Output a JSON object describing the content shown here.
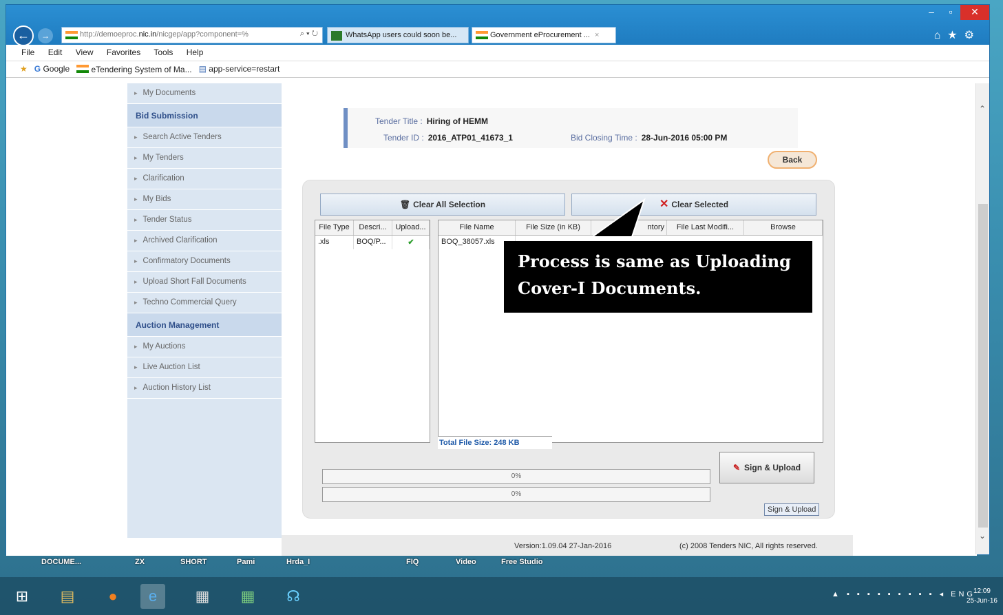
{
  "browser": {
    "address": {
      "prefix": "http://demoeproc.",
      "host": "nic.in",
      "suffix": "/nicgep/app?component=%"
    },
    "tabs": [
      {
        "label": "WhatsApp users could soon be..."
      },
      {
        "label": "Government eProcurement ..."
      }
    ],
    "menu": [
      "File",
      "Edit",
      "View",
      "Favorites",
      "Tools",
      "Help"
    ],
    "favorites": [
      "Google",
      "eTendering System of Ma...",
      "app-service=restart"
    ]
  },
  "sidebar": {
    "items_top": [
      "My Documents"
    ],
    "section_bid": "Bid Submission",
    "items_bid": [
      "Search Active Tenders",
      "My Tenders",
      "Clarification",
      "My Bids",
      "Tender Status",
      "Archived Clarification",
      "Confirmatory Documents",
      "Upload Short Fall Documents",
      "Techno Commercial Query"
    ],
    "section_auction": "Auction Management",
    "items_auction": [
      "My Auctions",
      "Live Auction List",
      "Auction History List"
    ]
  },
  "tender": {
    "title_label": "Tender Title :",
    "title_value": "Hiring of HEMM",
    "id_label": "Tender ID :",
    "id_value": "2016_ATP01_41673_1",
    "closing_label": "Bid Closing Time :",
    "closing_value": "28-Jun-2016 05:00 PM",
    "back": "Back"
  },
  "upload": {
    "clear_all": "Clear All Selection",
    "clear_selected": "Clear Selected",
    "left_columns": [
      "File Type",
      "Descri...",
      "Upload..."
    ],
    "left_row": {
      "type": ".xls",
      "desc": "BOQ/P...",
      "upload": "✔"
    },
    "right_columns": [
      "File Name",
      "File Size (in KB)",
      "ntory",
      "File Last Modifi...",
      "Browse"
    ],
    "right_row": {
      "name": "BOQ_38057.xls"
    },
    "total": "Total File Size: 248 KB",
    "progress1": "0%",
    "progress2": "0%",
    "sign_upload": "Sign & Upload",
    "tooltip": "Sign & Upload"
  },
  "callout": {
    "line1": "Process is same as Uploading",
    "line2": "Cover-I Documents."
  },
  "footer": {
    "version": "Version:1.09.04 27-Jan-2016",
    "copyright": "(c) 2008 Tenders NIC, All rights reserved."
  },
  "desktop_strip": [
    "DOCUME...",
    "ZX",
    "SHORT",
    "Pami",
    "Hrda_I",
    "FIQ",
    "Video",
    "Free Studio"
  ],
  "clock": {
    "time": "12:09",
    "date": "25-Jun-16"
  },
  "tray_lang": "ENG"
}
